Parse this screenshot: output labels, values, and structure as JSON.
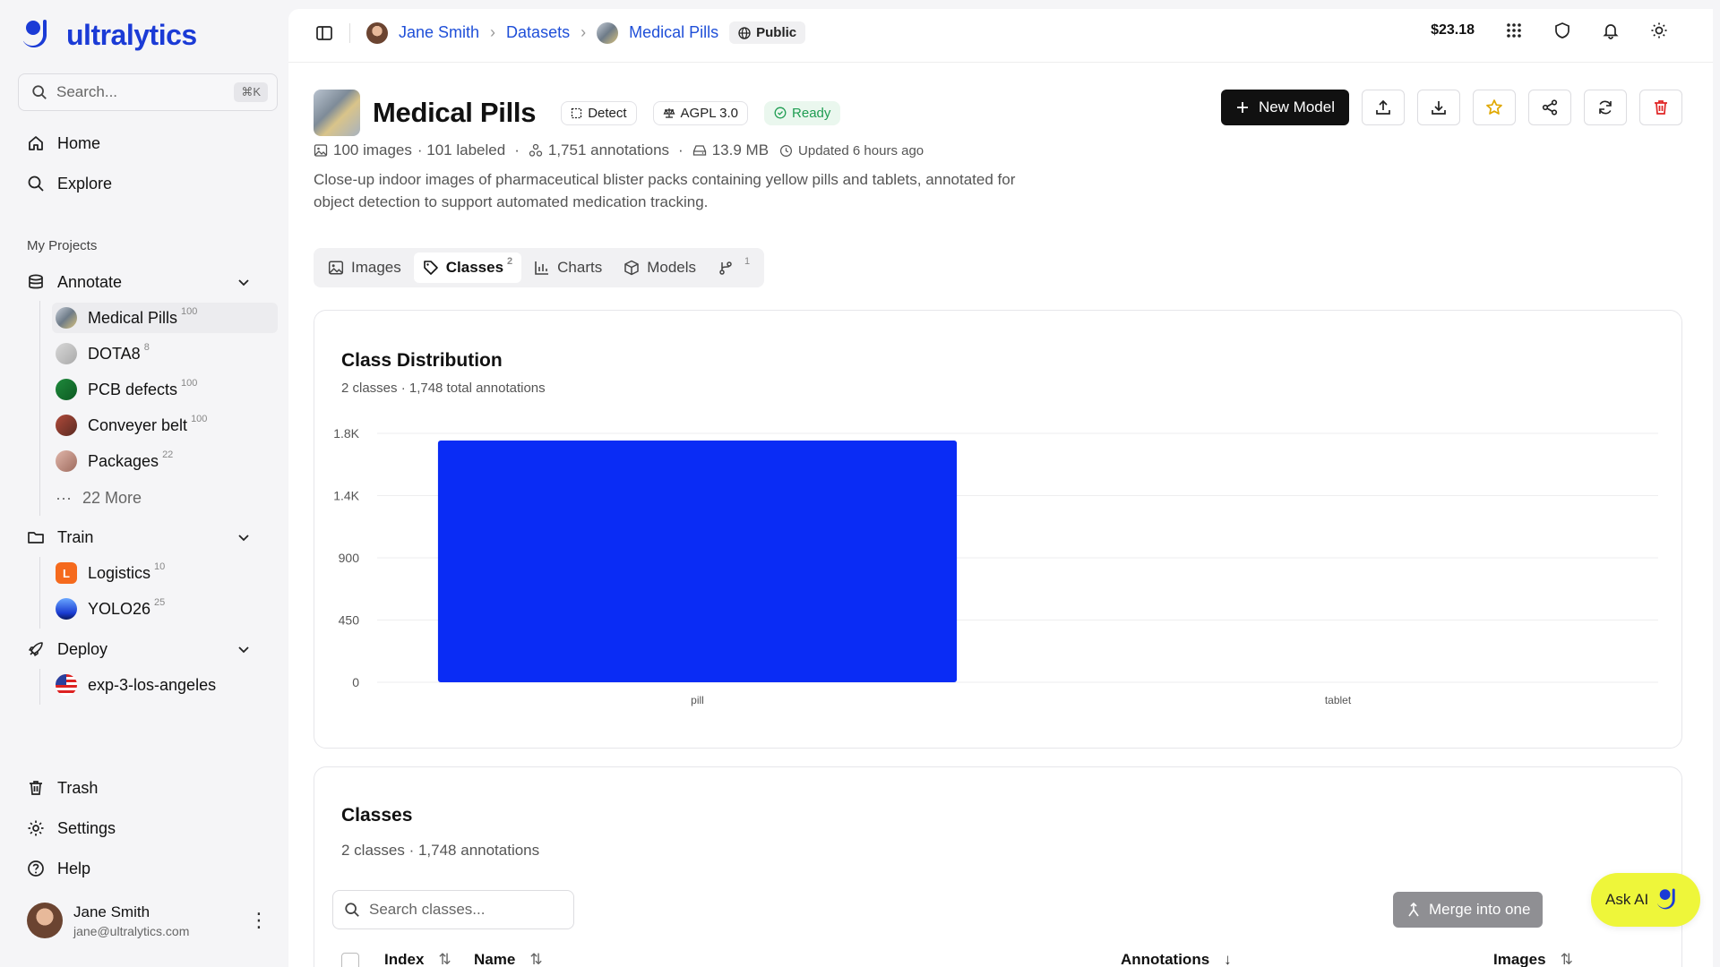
{
  "app": {
    "logo_text": "ultralytics"
  },
  "sidebar": {
    "search_placeholder": "Search...",
    "search_shortcut": "⌘K",
    "nav": [
      {
        "label": "Home"
      },
      {
        "label": "Explore"
      }
    ],
    "section_label": "My Projects",
    "annotate": {
      "label": "Annotate",
      "projects": [
        {
          "label": "Medical Pills",
          "count": "100"
        },
        {
          "label": "DOTA8",
          "count": "8"
        },
        {
          "label": "PCB defects",
          "count": "100"
        },
        {
          "label": "Conveyer belt",
          "count": "100"
        },
        {
          "label": "Packages",
          "count": "22"
        }
      ],
      "more": "22 More"
    },
    "train": {
      "label": "Train",
      "projects": [
        {
          "label": "Logistics",
          "count": "10",
          "initial": "L"
        },
        {
          "label": "YOLO26",
          "count": "25"
        }
      ]
    },
    "deploy": {
      "label": "Deploy",
      "projects": [
        {
          "label": "exp-3-los-angeles"
        }
      ]
    },
    "bottom": [
      {
        "label": "Trash"
      },
      {
        "label": "Settings"
      },
      {
        "label": "Help"
      }
    ],
    "user": {
      "name": "Jane Smith",
      "email": "jane@ultralytics.com"
    }
  },
  "topbar": {
    "breadcrumb": [
      {
        "label": "Jane Smith"
      },
      {
        "label": "Datasets"
      },
      {
        "label": "Medical Pills"
      }
    ],
    "visibility": "Public",
    "credit": "$23.18"
  },
  "dataset": {
    "title": "Medical Pills",
    "task": "Detect",
    "license": "AGPL 3.0",
    "status": "Ready",
    "images": "100 images",
    "labeled": "· 101 labeled",
    "annotations": "1,751 annotations",
    "size": "13.9 MB",
    "updated": "Updated 6 hours ago",
    "description": "Close-up indoor images of pharmaceutical blister packs containing yellow pills and tablets, annotated for object detection to support automated medication tracking.",
    "new_model": "New Model"
  },
  "tabs": [
    {
      "label": "Images"
    },
    {
      "label": "Classes",
      "count": "2"
    },
    {
      "label": "Charts"
    },
    {
      "label": "Models"
    },
    {
      "label": "",
      "count": "1"
    }
  ],
  "distribution": {
    "title": "Class Distribution",
    "subtitle": "2 classes · 1,748 total annotations"
  },
  "chart_data": {
    "type": "bar",
    "categories": [
      "pill",
      "tablet"
    ],
    "values": [
      1748,
      0
    ],
    "yticks": [
      "0",
      "450",
      "900",
      "1.4K",
      "1.8K"
    ],
    "ytick_values": [
      0,
      450,
      900,
      1350,
      1800
    ],
    "ylim": [
      0,
      1800
    ],
    "bar_color": "#0a2cf5",
    "grid": true
  },
  "classes": {
    "title": "Classes",
    "subtitle": "2 classes · 1,748 annotations",
    "search_placeholder": "Search classes...",
    "merge": "Merge into one",
    "columns": {
      "index": "Index",
      "name": "Name",
      "annotations": "Annotations",
      "images": "Images"
    }
  },
  "ask_ai": "Ask AI"
}
